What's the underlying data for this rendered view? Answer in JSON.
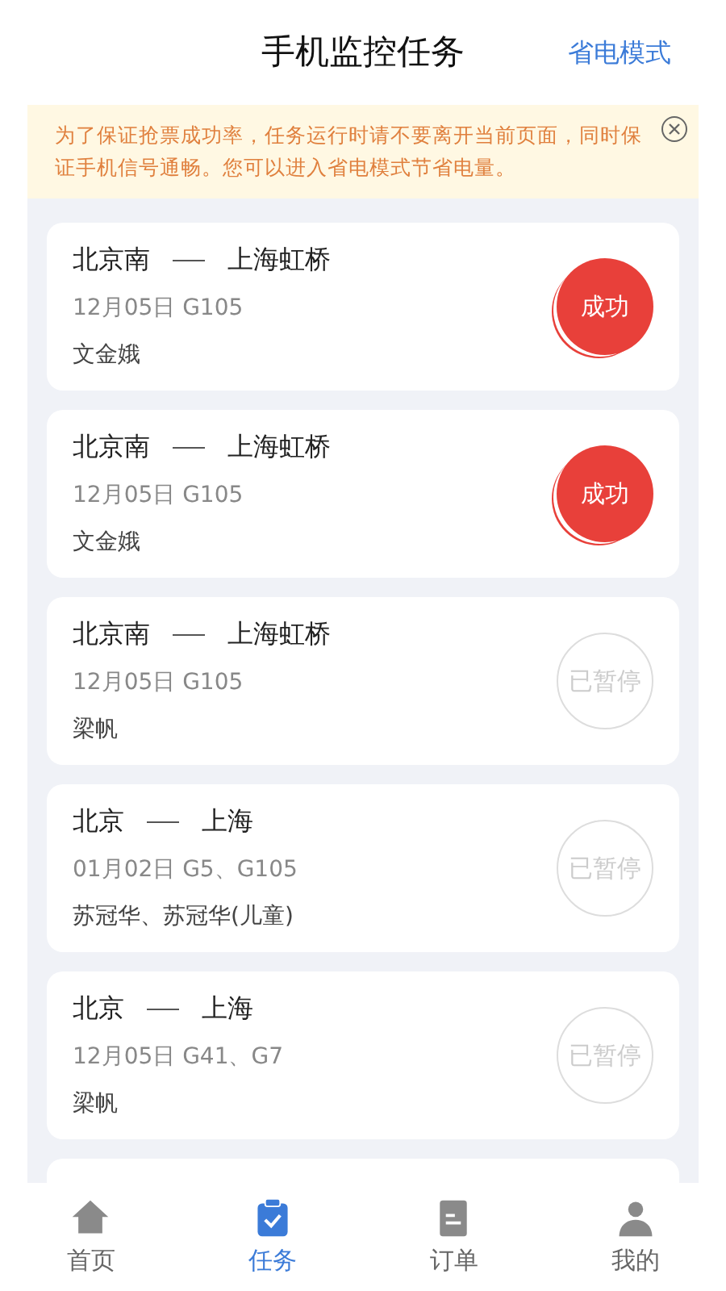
{
  "header": {
    "title": "手机监控任务",
    "action": "省电模式"
  },
  "notice": {
    "text": "为了保证抢票成功率，任务运行时请不要离开当前页面，同时保证手机信号通畅。您可以进入省电模式节省电量。"
  },
  "tasks": [
    {
      "from": "北京南",
      "to": "上海虹桥",
      "detail": "12月05日 G105",
      "passengers": "文金娥",
      "kind": "success",
      "status_label": "成功"
    },
    {
      "from": "北京南",
      "to": "上海虹桥",
      "detail": "12月05日 G105",
      "passengers": "文金娥",
      "kind": "success",
      "status_label": "成功"
    },
    {
      "from": "北京南",
      "to": "上海虹桥",
      "detail": "12月05日 G105",
      "passengers": "梁帆",
      "kind": "paused",
      "status_label": "已暂停"
    },
    {
      "from": "北京",
      "to": "上海",
      "detail": "01月02日 G5、G105",
      "passengers": "苏冠华、苏冠华(儿童)",
      "kind": "paused",
      "status_label": "已暂停"
    },
    {
      "from": "北京",
      "to": "上海",
      "detail": "12月05日 G41、G7",
      "passengers": "梁帆",
      "kind": "paused",
      "status_label": "已暂停"
    }
  ],
  "tabbar": [
    {
      "label": "首页",
      "selected": false
    },
    {
      "label": "任务",
      "selected": true
    },
    {
      "label": "订单",
      "selected": false
    },
    {
      "label": "我的",
      "selected": false
    }
  ]
}
